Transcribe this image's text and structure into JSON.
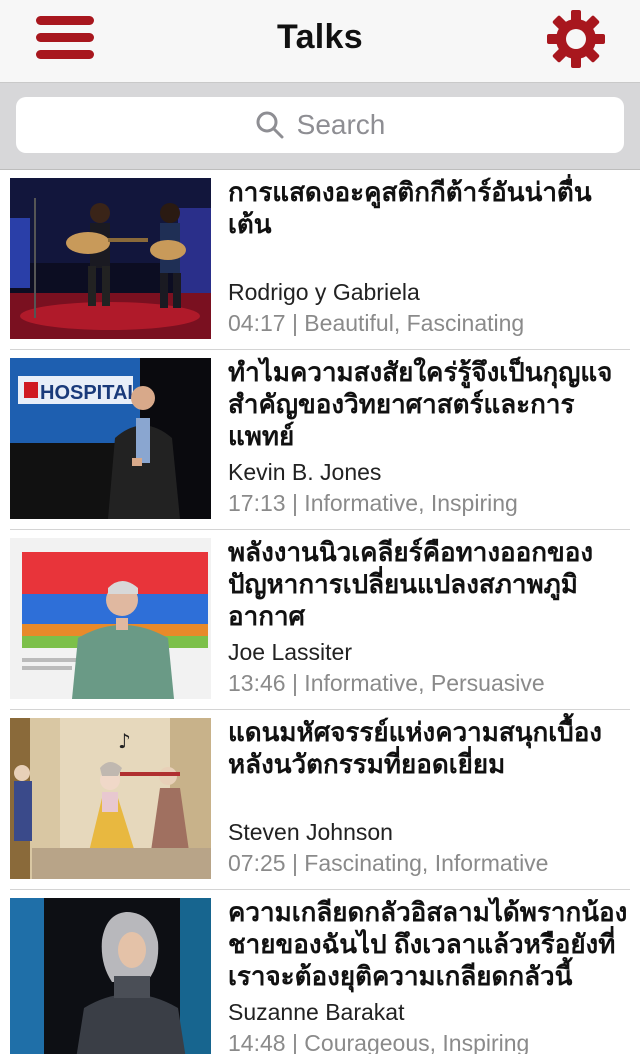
{
  "header": {
    "title": "Talks",
    "menu_icon": "hamburger-menu-icon",
    "settings_icon": "gear-icon",
    "accent_color": "#a8171e"
  },
  "search": {
    "placeholder": "Search",
    "icon": "search-icon"
  },
  "talks": [
    {
      "title": "การแสดงอะคูสติกกีต้าร์อันน่าตื่นเต้น",
      "speaker": "Rodrigo y Gabriela",
      "meta": "04:17 | Beautiful, Fascinating"
    },
    {
      "title": "ทำไมความสงสัยใคร่รู้จึงเป็นกุญแจสำคัญของวิทยาศาสตร์และการแพทย์",
      "speaker": "Kevin B. Jones",
      "meta": "17:13 | Informative, Inspiring",
      "thumb_text": "HOSPITAL"
    },
    {
      "title": "พลังงานนิวเคลียร์คือทางออกของปัญหาการเปลี่ยนแปลงสภาพภูมิอากาศ",
      "speaker": "Joe Lassiter",
      "meta": "13:46 | Informative, Persuasive"
    },
    {
      "title": "แดนมหัศจรรย์แห่งความสนุกเบื้องหลังนวัตกรรมที่ยอดเยี่ยม",
      "speaker": "Steven Johnson",
      "meta": "07:25 | Fascinating, Informative"
    },
    {
      "title": "ความเกลียดกลัวอิสลามได้พรากน้องชายของฉันไป ถึงเวลาแล้วหรือยังที่เราจะต้องยุติความเกลียดกลัวนี้",
      "speaker": "Suzanne Barakat",
      "meta": "14:48 | Courageous, Inspiring"
    }
  ]
}
